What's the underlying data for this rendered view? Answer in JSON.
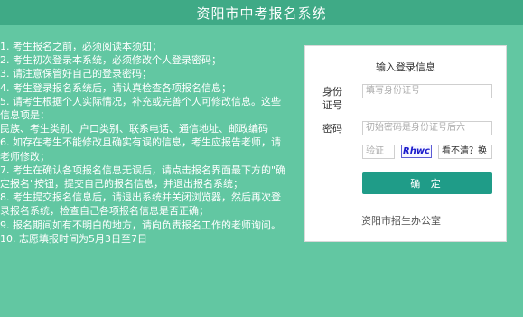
{
  "header": {
    "title": "资阳市中考报名系统"
  },
  "notice": {
    "items": [
      "1. 考生报名之前，必须阅读本须知；",
      "2. 考生初次登录本系统，必须修改个人登录密码；",
      "3. 请注意保管好自己的登录密码；",
      "4. 考生登录报名系统后，请认真检查各项报名信息；",
      "5. 请考生根据个人实际情况，补充或完善个人可修改信息。这些信息项是：",
      "民族、考生类别、户口类别、联系电话、通信地址、邮政编码",
      "6. 如存在考生不能修改且确实有误的信息，考生应报告老师，请老师修改；",
      "7. 考生在确认各项报名信息无误后，请点击报名界面最下方的\"确定报名\"按钮，提交自己的报名信息，并退出报名系统；",
      "8. 考生提交报名信息后，请退出系统并关闭浏览器，然后再次登录报名系统，检查自己各项报名信息是否正确；",
      "9. 报名期间如有不明白的地方，请向负责报名工作的老师询问。",
      "10. 志愿填报时间为5月3日至7日"
    ]
  },
  "login": {
    "title": "输入登录信息",
    "id_label_1": "身份",
    "id_label_2": "证号",
    "id_placeholder": "填写身份证号",
    "pwd_label": "密码",
    "pwd_placeholder": "初始密码是身份证号后六",
    "captcha_placeholder": "验证",
    "captcha_text": "Rhwc",
    "refresh_label": "看不清？换",
    "submit_label": "确 定"
  },
  "footer": {
    "text": "资阳市招生办公室"
  }
}
